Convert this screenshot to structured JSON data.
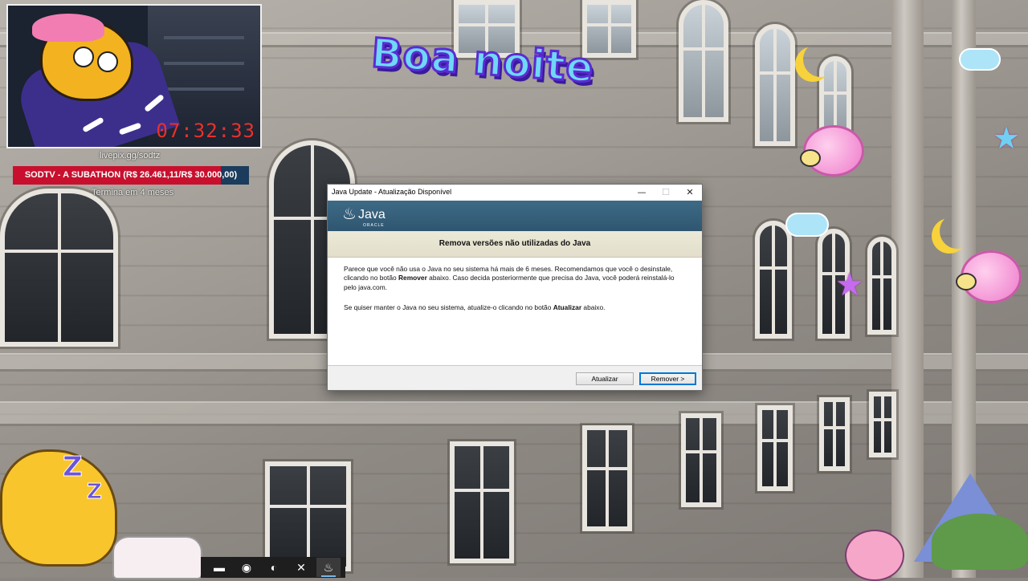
{
  "stream": {
    "timer": "07:32:33",
    "live_link": "livepix.gg/sodtz",
    "goal_text": "SODTV - A SUBATHON (R$ 26.461,11/R$ 30.000,00)",
    "goal_progress": 0.882,
    "goal_subtext": "Termina em 4 meses",
    "greeting": "Boa noite"
  },
  "dialog": {
    "window_title": "Java Update - Atualização Disponível",
    "brand_name": "Java",
    "brand_sub": "ORACLE",
    "heading": "Remova versões não utilizadas do Java",
    "para1_a": "Parece que você não usa o Java no seu sistema há mais de 6 meses. Recomendamos que você o desinstale, clicando no botão ",
    "para1_bold": "Remover",
    "para1_b": " abaixo. Caso decida posteriormente que precisa do Java, você poderá reinstalá-lo pelo java.com.",
    "para2_a": "Se quiser manter o Java no seu sistema, atualize-o clicando no botão ",
    "para2_bold": "Atualizar",
    "para2_b": " abaixo.",
    "btn_update": "Atualizar",
    "btn_remove": "Remover >",
    "controls": {
      "minimize": "—",
      "maximize": "☐",
      "close": "✕"
    }
  },
  "taskbar": {
    "items": [
      {
        "name": "file-explorer-icon",
        "glyph": "▬"
      },
      {
        "name": "discord-icon",
        "glyph": "◉"
      },
      {
        "name": "edge-icon",
        "glyph": "◐"
      },
      {
        "name": "app-icon",
        "glyph": "✕"
      },
      {
        "name": "java-update-icon",
        "glyph": "♨"
      }
    ]
  }
}
